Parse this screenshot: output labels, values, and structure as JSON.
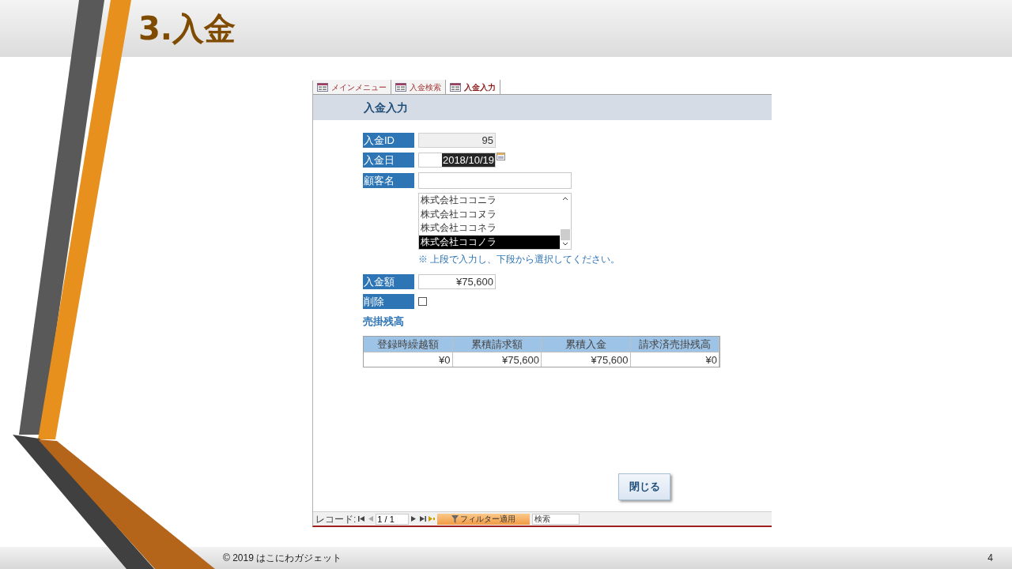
{
  "slide": {
    "title": "3.入金",
    "footer": "© 2019 はこにわガジェット",
    "page_number": "4"
  },
  "access": {
    "tabs": [
      {
        "label": "メインメニュー",
        "selected": false
      },
      {
        "label": "入金検索",
        "selected": false
      },
      {
        "label": "入金入力",
        "selected": true
      }
    ],
    "form_title": "入金入力",
    "fields": [
      {
        "kind": "id",
        "label": "入金ID",
        "value": "95"
      },
      {
        "kind": "date",
        "label": "入金日",
        "value": "2018/10/19"
      },
      {
        "kind": "text",
        "label": "顧客名"
      }
    ],
    "customer_list": [
      {
        "label": "株式会社ココニラ",
        "selected": false
      },
      {
        "label": "株式会社ココヌラ",
        "selected": false
      },
      {
        "label": "株式会社ココネラ",
        "selected": false
      },
      {
        "label": "株式会社ココノラ",
        "selected": true
      }
    ],
    "hint": "※ 上段で入力し、下段から選択してください。",
    "amount": {
      "label": "入金額",
      "value": "¥75,600"
    },
    "delete": {
      "label": "削除",
      "checked": false
    },
    "balance_title": "売掛残高",
    "table": {
      "columns": [
        "登録時繰越額",
        "累積請求額",
        "累積入金",
        "請求済売掛残高"
      ],
      "rows": [
        [
          "¥0",
          "¥75,600",
          "¥75,600",
          "¥0"
        ]
      ]
    },
    "close_button": "閉じる",
    "record_nav": {
      "label": "レコード:",
      "position": "1 / 1",
      "filter": "フィルター適用",
      "search": "検索"
    }
  }
}
